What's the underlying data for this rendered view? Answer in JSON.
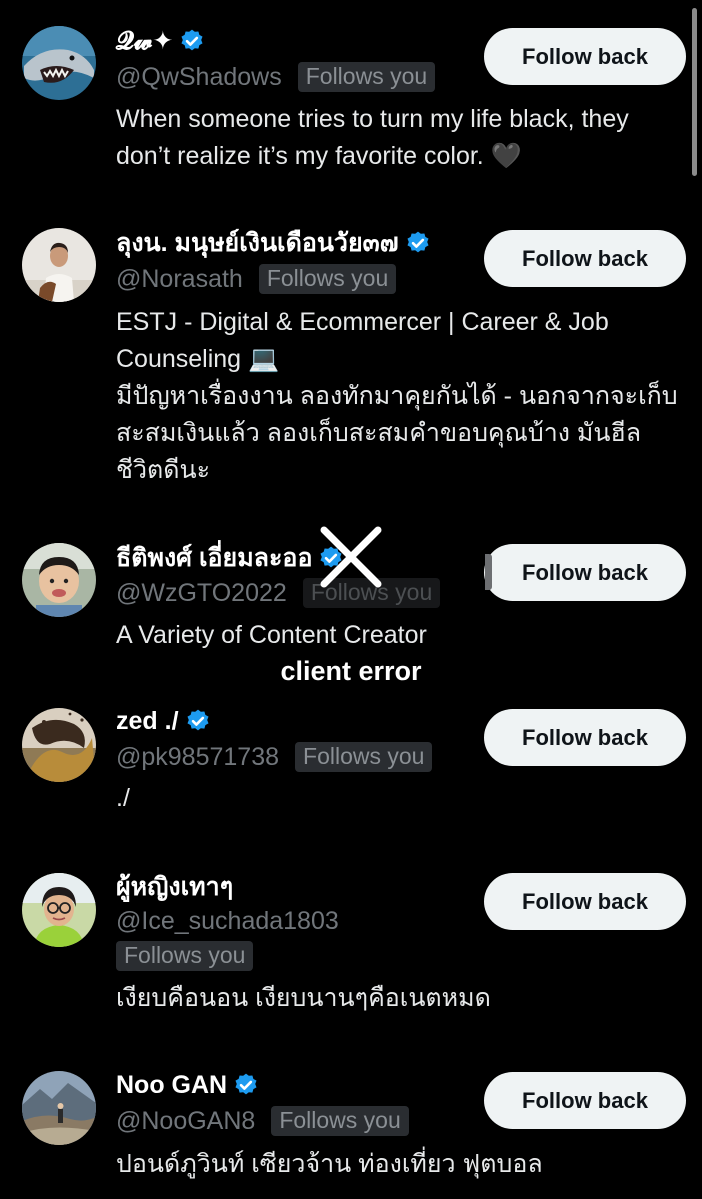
{
  "follow_button_label": "Follow back",
  "follows_you_label": "Follows you",
  "error": {
    "message": "client error",
    "icon": "close-x-icon"
  },
  "accounts": [
    {
      "display_name": "𝓠𝔀✦",
      "handle": "@QwShadows",
      "verified": true,
      "bio": "When someone tries to turn my life black, they don’t realize it’s my favorite color. 🖤",
      "avatar": "shark-avatar"
    },
    {
      "display_name": "ลุงน. มนุษย์เงินเดือนวัย๓๗",
      "handle": "@Norasath",
      "verified": true,
      "bio_lines": [
        "ESTJ - Digital & Ecommercer | Career & Job Counseling 💻",
        "มีปัญหาเรื่องงาน ลองทักมาคุยกันได้ - นอกจากจะเก็บสะสมเงินแล้ว ลองเก็บสะสมคำขอบคุณบ้าง มันฮีลชีวิตดีนะ"
      ],
      "avatar": "man-portrait-avatar"
    },
    {
      "display_name": "ธีติพงศ์ เอี่ยมละออ",
      "handle": "@WzGTO2022",
      "verified": true,
      "bio": "A Variety of Content Creator",
      "avatar": "child-photo-avatar"
    },
    {
      "display_name": "zed ./",
      "handle": "@pk98571738",
      "verified": true,
      "bio": "./",
      "avatar": "abstract-art-avatar"
    },
    {
      "display_name": "ผู้หญิงเทาๆ",
      "handle": "@Ice_suchada1803",
      "verified": false,
      "bio": "เงียบคือนอน เงียบนานๆคือเนตหมด",
      "avatar": "woman-glasses-avatar"
    },
    {
      "display_name": "Noo GAN",
      "handle": "@NooGAN8",
      "verified": true,
      "bio": "ปอนด์ภูวินท์ เซียวจ้าน ท่องเที่ยว ฟุตบอล",
      "avatar": "mountain-photo-avatar"
    }
  ],
  "colors": {
    "background": "#000000",
    "verified_badge": "#1d9bf0",
    "button_bg": "#eff3f4",
    "muted_text": "#71767b"
  }
}
